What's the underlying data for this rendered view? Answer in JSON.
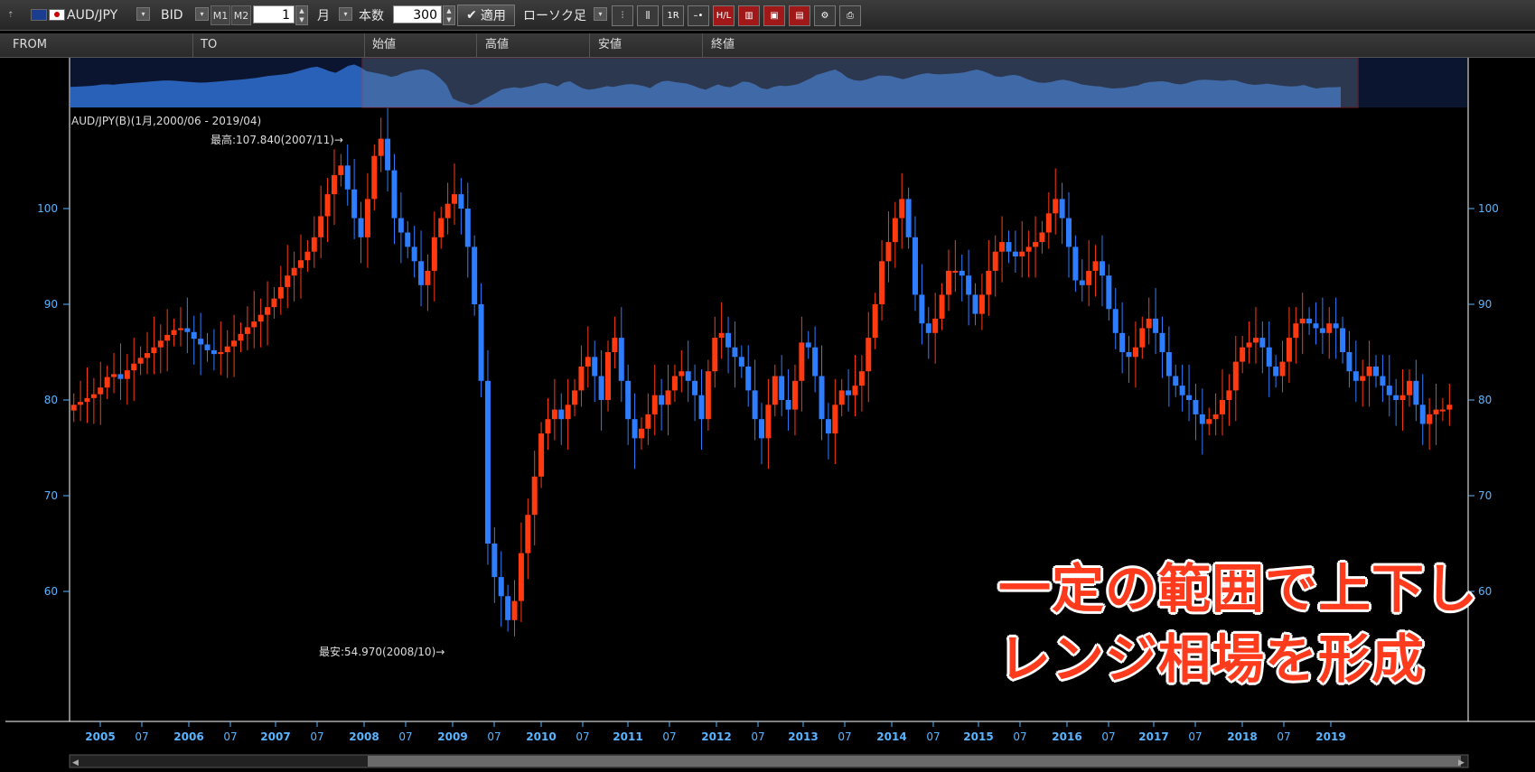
{
  "toolbar": {
    "pair": "AUD/JPY",
    "price_type": "BID",
    "m1_label": "M1",
    "m2_label": "M2",
    "period_value": "1",
    "period_unit": "月",
    "count_label": "本数",
    "count_value": "300",
    "apply_label": "適用",
    "chart_style": "ローソク足"
  },
  "columns": [
    "FROM",
    "TO",
    "始値",
    "高値",
    "安値",
    "終値"
  ],
  "chart_title": "AUD/JPY(B)(1月,2000/06 - 2019/04)",
  "high_annotation": "最高:107.840(2007/11)→",
  "low_annotation": "最安:54.970(2008/10)→",
  "overlay_text": [
    "一定の範囲で上下し",
    "レンジ相場を形成"
  ],
  "colors": {
    "up": "#ff3a10",
    "down": "#2f7dff",
    "axis": "#5ab4ff"
  },
  "chart_data": {
    "type": "candlestick",
    "title": "AUD/JPY(B)(1月,2000/06 - 2019/04)",
    "ylim": [
      52,
      112
    ],
    "y_ticks": [
      60,
      70,
      80,
      90,
      100
    ],
    "x_tick_labels": [
      "2005",
      "07",
      "2006",
      "07",
      "2007",
      "07",
      "2008",
      "07",
      "2009",
      "07",
      "2010",
      "07",
      "2011",
      "07",
      "2012",
      "07",
      "2013",
      "07",
      "2014",
      "07",
      "2015",
      "07",
      "2016",
      "07",
      "2017",
      "07",
      "2018",
      "07",
      "2019"
    ],
    "annotations": [
      {
        "label": "最高:107.840(2007/11)",
        "value": 107.84
      },
      {
        "label": "最安:54.970(2008/10)",
        "value": 54.97
      }
    ],
    "close_series": [
      79.5,
      79.8,
      80.2,
      80.6,
      81.3,
      82.4,
      82.7,
      82.2,
      83.1,
      83.8,
      84.4,
      84.9,
      85.5,
      86.2,
      86.8,
      87.3,
      87.5,
      87.1,
      86.4,
      85.8,
      85.2,
      84.8,
      85.0,
      85.6,
      86.2,
      86.9,
      87.6,
      88.2,
      88.9,
      89.7,
      90.6,
      91.8,
      93.0,
      93.8,
      94.6,
      95.5,
      97.0,
      99.2,
      101.5,
      103.5,
      104.5,
      102.0,
      99.0,
      97.0,
      101.0,
      105.5,
      107.3,
      104.0,
      99.0,
      97.5,
      96.0,
      94.5,
      92.0,
      93.5,
      97.0,
      99.0,
      100.5,
      101.5,
      100.0,
      96.0,
      90.0,
      82.0,
      65.0,
      61.5,
      59.5,
      57.0,
      59.0,
      64.0,
      68.0,
      72.0,
      76.5,
      78.0,
      79.0,
      78.0,
      79.5,
      81.0,
      83.5,
      84.5,
      82.5,
      80.0,
      85.0,
      86.5,
      82.0,
      78.0,
      76.0,
      77.0,
      78.5,
      80.5,
      79.5,
      81.0,
      82.5,
      83.0,
      82.0,
      80.5,
      78.0,
      83.0,
      86.5,
      87.0,
      85.5,
      84.5,
      83.5,
      81.0,
      78.0,
      76.0,
      79.5,
      82.5,
      80.0,
      79.0,
      82.0,
      86.0,
      85.5,
      82.5,
      78.0,
      76.5,
      79.5,
      81.0,
      80.5,
      81.5,
      83.0,
      86.5,
      90.0,
      94.5,
      96.5,
      99.0,
      101.0,
      97.0,
      91.0,
      88.0,
      87.0,
      88.5,
      91.0,
      93.5,
      93.5,
      93.0,
      91.0,
      89.0,
      91.0,
      93.5,
      95.5,
      96.5,
      95.5,
      95.0,
      95.5,
      96.0,
      96.5,
      97.5,
      99.5,
      101.0,
      99.0,
      96.0,
      92.5,
      92.0,
      93.5,
      94.5,
      93.0,
      89.5,
      87.0,
      85.0,
      84.5,
      85.5,
      87.5,
      88.5,
      87.0,
      85.0,
      82.5,
      81.5,
      80.5,
      80.0,
      78.5,
      77.5,
      78.0,
      78.5,
      80.0,
      81.0,
      84.0,
      85.5,
      86.0,
      86.5,
      85.5,
      83.5,
      82.5,
      84.0,
      86.5,
      88.0,
      88.5,
      88.0,
      87.5,
      87.0,
      88.0,
      87.5,
      85.0,
      83.0,
      82.0,
      82.5,
      83.5,
      82.5,
      81.5,
      80.5,
      80.0,
      80.5,
      82.0,
      79.5,
      77.5,
      78.5,
      79.0,
      79.0,
      79.5
    ]
  }
}
